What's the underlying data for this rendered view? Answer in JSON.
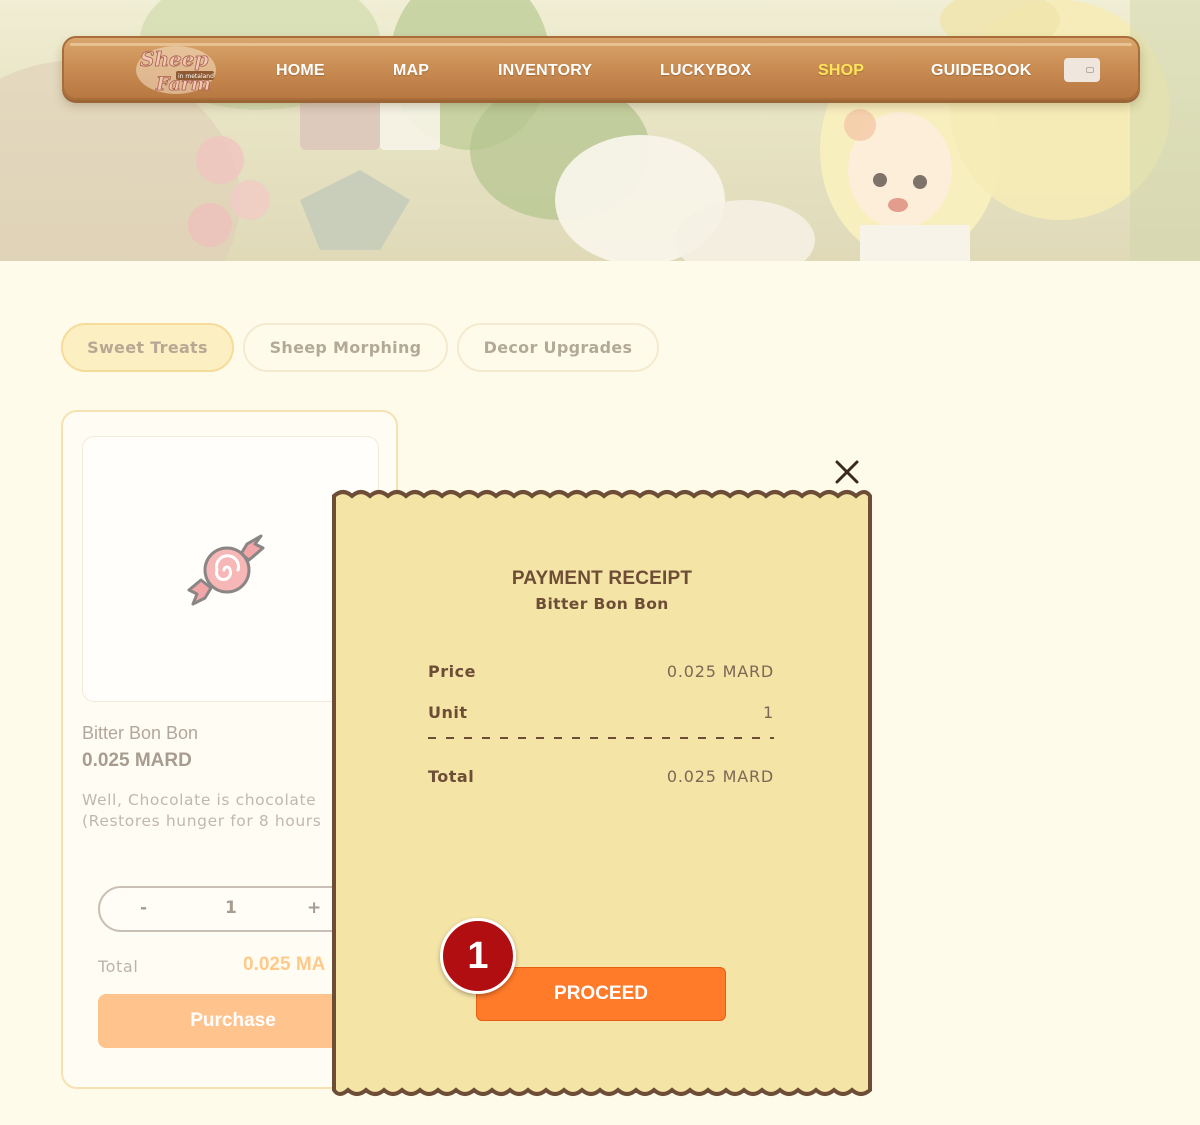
{
  "nav": {
    "logo_text": "Sheep Farm in metaland",
    "items": [
      {
        "label": "HOME",
        "active": false
      },
      {
        "label": "MAP",
        "active": false
      },
      {
        "label": "INVENTORY",
        "active": false
      },
      {
        "label": "LUCKYBOX",
        "active": false
      },
      {
        "label": "SHOP",
        "active": true
      },
      {
        "label": "GUIDEBOOK",
        "active": false
      }
    ],
    "wallet_icon": "wallet-icon"
  },
  "tabs": [
    {
      "label": "Sweet Treats",
      "active": true
    },
    {
      "label": "Sheep Morphing",
      "active": false
    },
    {
      "label": "Decor Upgrades",
      "active": false
    }
  ],
  "product": {
    "image_icon": "candy-icon",
    "name": "Bitter Bon Bon",
    "price": "0.025 MARD",
    "description": "Well, Chocolate is chocolate\n(Restores hunger for 8 hours",
    "qty_minus": "-",
    "qty_value": "1",
    "qty_plus": "+",
    "total_label": "Total",
    "total_value": "0.025 MA",
    "purchase_label": "Purchase"
  },
  "receipt": {
    "title": "PAYMENT RECEIPT",
    "item_name": "Bitter Bon Bon",
    "rows": [
      {
        "label": "Price",
        "value": "0.025 MARD"
      },
      {
        "label": "Unit",
        "value": "1"
      }
    ],
    "total": {
      "label": "Total",
      "value": "0.025 MARD"
    },
    "proceed_label": "PROCEED",
    "close_icon": "close-icon",
    "step_badge": "1"
  },
  "colors": {
    "background": "#fffbea",
    "nav_active": "#ffe45c",
    "proceed": "#ff7a29",
    "badge": "#b00e10",
    "receipt_paper": "#f4e4a6",
    "receipt_border": "#6d4d36"
  }
}
